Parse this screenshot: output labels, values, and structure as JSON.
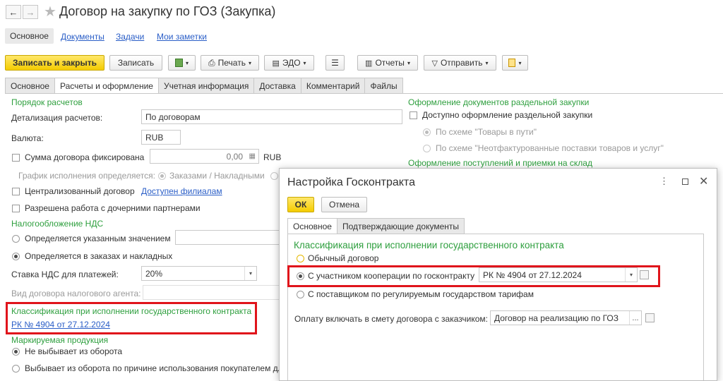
{
  "window": {
    "title": "Договор на закупку по ГОЗ (Закупка)"
  },
  "nav_links": [
    "Основное",
    "Документы",
    "Задачи",
    "Мои заметки"
  ],
  "toolbar": {
    "save_close": "Записать и закрыть",
    "save": "Записать",
    "print": "Печать",
    "edo": "ЭДО",
    "reports": "Отчеты",
    "send": "Отправить"
  },
  "tabs": [
    "Основное",
    "Расчеты и оформление",
    "Учетная информация",
    "Доставка",
    "Комментарий",
    "Файлы"
  ],
  "left": {
    "section_order": "Порядок расчетов",
    "detail_label": "Детализация расчетов:",
    "detail_value": "По договорам",
    "currency_label": "Валюта:",
    "currency_value": "RUB",
    "fixed_sum_label": "Сумма договора фиксирована",
    "fixed_sum_value": "0,00",
    "fixed_sum_currency": "RUB",
    "schedule_label": "График исполнения определяется:",
    "schedule_option": "Заказами / Накладными",
    "centralized_label": "Централизованный договор",
    "centralized_link": "Доступен филиалам",
    "subsidiaries_label": "Разрешена работа с дочерними партнерами",
    "vat_section": "Налогообложение НДС",
    "vat_option1": "Определяется указанным значением",
    "vat_option2": "Определяется в заказах и накладных",
    "vat_rate_label": "Ставка НДС для платежей:",
    "vat_rate_value": "20%",
    "agent_label": "Вид договора налогового агента:",
    "gos_section": "Классификация при исполнении государственного контракта",
    "gos_link": "РК № 4904 от 27.12.2024",
    "marked_section": "Маркируемая продукция",
    "marked_option1": "Не выбывает из оборота",
    "marked_option2": "Выбывает из оборота по причине использования покупателем дл"
  },
  "right": {
    "separate_section": "Оформление документов раздельной закупки",
    "separate_checkbox": "Доступно оформление раздельной закупки",
    "scheme1": "По схеме \"Товары в пути\"",
    "scheme2": "По схеме \"Неотфактурованные поставки товаров и услуг\"",
    "receipts_section": "Оформление поступлений и приемки на склад"
  },
  "dialog": {
    "title": "Настройка Госконтракта",
    "ok": "ОК",
    "cancel": "Отмена",
    "tabs": [
      "Основное",
      "Подтверждающие документы"
    ],
    "section": "Классификация при исполнении государственного контракта",
    "option_regular": "Обычный договор",
    "option_coop": "С участником кооперации по госконтракту",
    "coop_value": "РК № 4904 от 27.12.2024",
    "option_tariff": "С поставщиком по регулируемым государством тарифам",
    "payment_label": "Оплату включать в смету договора с заказчиком:",
    "payment_value": "Договор на реализацию по ГОЗ"
  },
  "colors": {
    "accent_green": "#2e9f3e",
    "link_blue": "#2a5ec7",
    "highlight_red": "#e0141b",
    "primary_yellow": "#f4cc00"
  }
}
